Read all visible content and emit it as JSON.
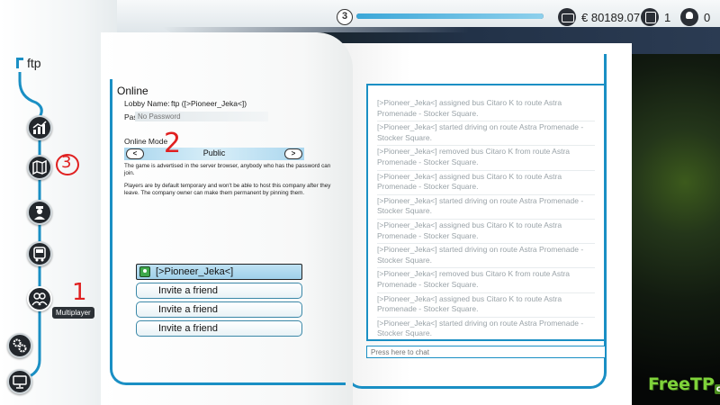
{
  "colors": {
    "accent": "#1a8fc4",
    "selector": "#a9d6ee",
    "annotation": "#e02020",
    "watermark": "#7fd33a"
  },
  "status_bar": {
    "level": "3",
    "progress": 1.0,
    "money": "€ 80189.07",
    "money_icon": "money-icon",
    "buses": "1",
    "bus_icon": "bus-icon",
    "drivers": "0",
    "driver_icon": "driver-icon"
  },
  "sidebar": {
    "company_name": "ftp",
    "items": [
      {
        "name": "statistics",
        "icon": "chart-icon"
      },
      {
        "name": "map",
        "icon": "map-icon"
      },
      {
        "name": "drivers",
        "icon": "driver-icon"
      },
      {
        "name": "buses",
        "icon": "bus-icon"
      },
      {
        "name": "multiplayer",
        "icon": "people-icon",
        "tooltip": "Multiplayer"
      },
      {
        "name": "settings",
        "icon": "gears-icon"
      },
      {
        "name": "computer",
        "icon": "monitor-icon"
      }
    ]
  },
  "online": {
    "title": "Online",
    "lobby_label": "Lobby Name:",
    "lobby_value": "ftp ([>Pioneer_Jeka<])",
    "password_label": "Password:",
    "password_placeholder": "No Password",
    "mode_label": "Online Mode",
    "mode_prev": "<",
    "mode_value": "Public",
    "mode_next": ">",
    "mode_description": "The game is advertised in the server browser, anybody who has the password can join.",
    "players_description": "Players are by default temporary and won't be able to host this company after they leave. The company owner can make them permanent by pinning them.",
    "players": [
      {
        "name": "[>Pioneer_Jeka<]",
        "icon": "player-icon"
      }
    ],
    "invite_buttons": [
      "Invite a friend",
      "Invite a friend",
      "Invite a friend"
    ]
  },
  "chat": {
    "messages": [
      "[>Pioneer_Jeka<] assigned bus Citaro K to route Astra Promenade - Stocker Square.",
      "[>Pioneer_Jeka<] started driving on route Astra Promenade - Stocker Square.",
      "[>Pioneer_Jeka<] removed bus Citaro K from route Astra Promenade - Stocker Square.",
      "[>Pioneer_Jeka<] assigned bus Citaro K to route Astra Promenade - Stocker Square.",
      "[>Pioneer_Jeka<] started driving on route Astra Promenade - Stocker Square.",
      "[>Pioneer_Jeka<] assigned bus Citaro K to route Astra Promenade - Stocker Square.",
      "[>Pioneer_Jeka<] started driving on route Astra Promenade - Stocker Square.",
      "[>Pioneer_Jeka<] removed bus Citaro K from route Astra Promenade - Stocker Square.",
      "[>Pioneer_Jeka<] assigned bus Citaro K to route Astra Promenade - Stocker Square.",
      "[>Pioneer_Jeka<] started driving on route Astra Promenade - Stocker Square."
    ],
    "input_placeholder": "Press here to chat"
  },
  "annotations": [
    "1",
    "2",
    "3"
  ],
  "watermark": {
    "main": "FreeTP",
    "sub": "org"
  }
}
